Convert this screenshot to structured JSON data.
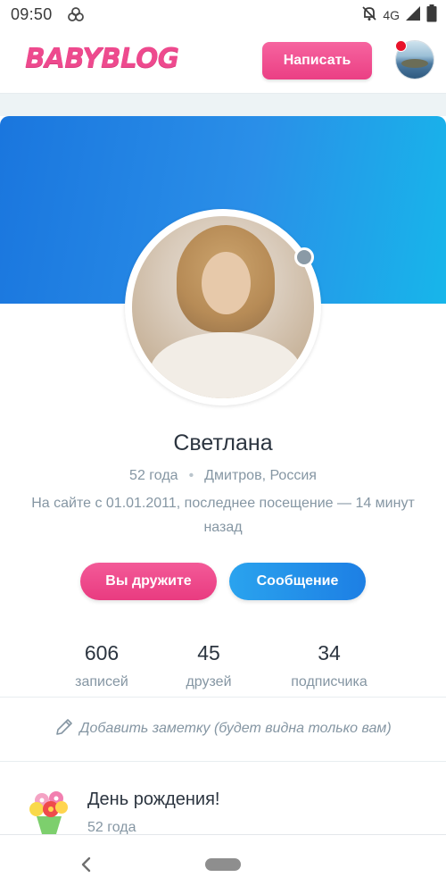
{
  "status_bar": {
    "time": "09:50",
    "network": "4G",
    "icons": [
      "pinwheel-icon",
      "bell-off-icon",
      "signal-icon",
      "battery-icon"
    ]
  },
  "header": {
    "logo": "BABYBLOG",
    "write_label": "Написать",
    "colors": {
      "brand_pink": "#ee4a8e",
      "notification_red": "#e8132a"
    }
  },
  "cover": {
    "colors": {
      "start": "#1a76de",
      "end": "#17b6ea"
    }
  },
  "profile": {
    "name": "Светлана",
    "age": "52 года",
    "location": "Дмитров, Россия",
    "last_visit": "На сайте с 01.01.2011, последнее посещение — 14 минут назад",
    "friends_label": "Вы дружите",
    "message_label": "Сообщение"
  },
  "stats": [
    {
      "value": "606",
      "label": "записей"
    },
    {
      "value": "45",
      "label": "друзей"
    },
    {
      "value": "34",
      "label": "подписчика"
    }
  ],
  "note": {
    "text": "Добавить заметку (будет видна только вам)",
    "icon": "pencil-icon"
  },
  "birthday": {
    "title": "День рождения!",
    "age": "52 года",
    "icon": "flower-bouquet-icon"
  },
  "nav": {
    "icons": [
      "back-icon",
      "home-pill-icon"
    ]
  }
}
